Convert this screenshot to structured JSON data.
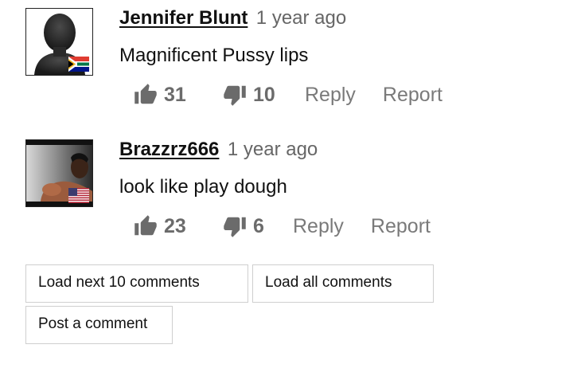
{
  "comments": [
    {
      "username": "Jennifer Blunt",
      "time": "1 year ago",
      "text": "Magnificent Pussy lips",
      "likes": "31",
      "dislikes": "10",
      "flag": "south-africa-flag",
      "avatar": "silhouette-avatar"
    },
    {
      "username": "Brazzrz666",
      "time": "1 year ago",
      "text": "look like play dough",
      "likes": "23",
      "dislikes": "6",
      "flag": "usa-flag",
      "avatar": "photo-avatar"
    }
  ],
  "actions": {
    "reply_label": "Reply",
    "report_label": "Report"
  },
  "buttons": {
    "load_next": "Load next 10 comments",
    "load_all": "Load all comments",
    "post_comment": "Post a comment"
  },
  "colors": {
    "text": "#111111",
    "muted": "#6b6b6b",
    "border": "#cfcfcf"
  }
}
